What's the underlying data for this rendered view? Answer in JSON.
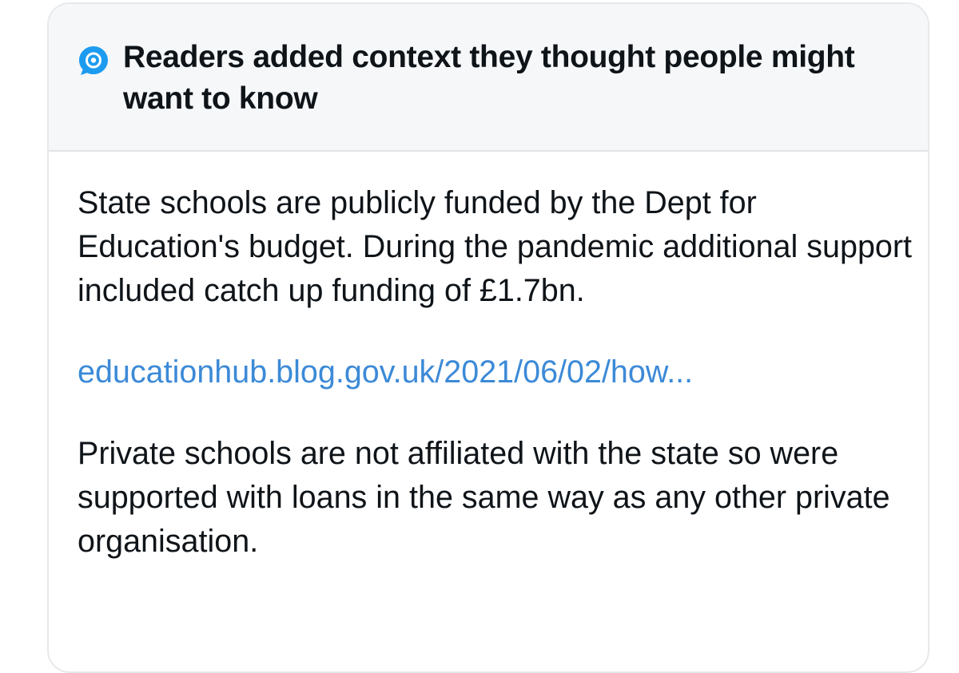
{
  "note": {
    "header_title": "Readers added context they thought people might want to know",
    "icon": "community-notes-icon",
    "accent_color": "#1d9bf0",
    "paragraph_1": "State schools are publicly funded by the Dept for Education's budget. During the pandemic additional support included catch up funding of £1.7bn.",
    "link_text": "educationhub.blog.gov.uk/2021/06/02/how...",
    "link_color": "#3c8ad7",
    "paragraph_2": "Private schools are not affiliated with the state so were supported with loans in the same way as any other private organisation."
  }
}
